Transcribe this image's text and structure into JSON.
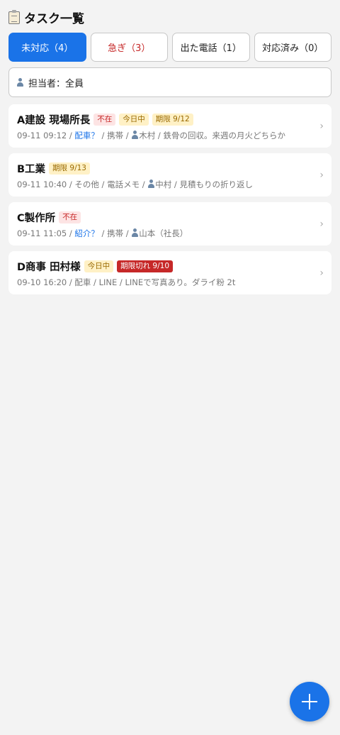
{
  "header": {
    "title": "タスク一覧",
    "icon": "clipboard-icon"
  },
  "tabs": [
    {
      "label": "未対応（4）",
      "active": true
    },
    {
      "label": "急ぎ（3）",
      "active": false
    },
    {
      "label": "出た電話（1）",
      "active": false
    },
    {
      "label": "対応済み（0）",
      "active": false
    }
  ],
  "filter": {
    "label": "担当者：全員"
  },
  "tasks": [
    {
      "title": "A建設 現場所長",
      "badges": [
        "不在",
        "今日中",
        "期限 9/12"
      ],
      "datetime": "09-11 09:12",
      "category": "配車？",
      "channel": "携帯",
      "assignee": "木村",
      "note": "鉄骨の回収。来週の月火どちらか"
    },
    {
      "title": "B工業",
      "badges": [
        "期限 9/13"
      ],
      "datetime": "09-11 10:40",
      "category": "その他",
      "channel": "電話メモ",
      "assignee": "中村",
      "note": "見積もりの折り返し"
    },
    {
      "title": "C製作所",
      "badges": [
        "不在"
      ],
      "datetime": "09-11 11:05",
      "category": "紹介？",
      "channel": "携帯",
      "assignee": "山本（社長）"
    },
    {
      "title": "D商事 田村様",
      "badges": [
        "今日中",
        "期限切れ 9/10"
      ],
      "datetime": "09-10 16:20",
      "category": "配車",
      "channel": "LINE",
      "note": "LINEで写真あり。ダライ粉 2t"
    }
  ],
  "separator": " / ",
  "chevron": "›",
  "fab": {
    "icon": "plus-icon",
    "color": "#1a73e8"
  },
  "colors": {
    "accent": "#1a73e8",
    "urgent": "#c62828"
  }
}
